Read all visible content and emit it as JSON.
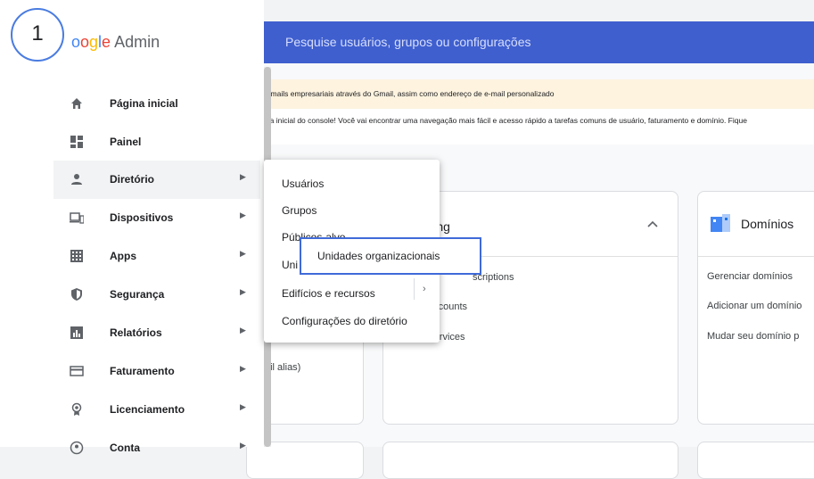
{
  "step_badge": "1",
  "logo": {
    "brand": "oogle",
    "product": "Admin"
  },
  "search": {
    "placeholder": "Pesquise usuários, grupos ou configurações"
  },
  "banners": {
    "warning": "e-mails empresariais através do Gmail, assim como endereço de e-mail personalizado",
    "info": "ina inicial do console! Você vai encontrar uma navegação mais fácil e acesso rápido a tarefas comuns de usuário, faturamento e domínio. Fique"
  },
  "nav": [
    {
      "label": "Página inicial",
      "icon": "home-icon",
      "has_arrow": false
    },
    {
      "label": "Painel",
      "icon": "dashboard-icon",
      "has_arrow": false
    },
    {
      "label": "Diretório",
      "icon": "person-icon",
      "has_arrow": true,
      "active": true
    },
    {
      "label": "Dispositivos",
      "icon": "devices-icon",
      "has_arrow": true
    },
    {
      "label": "Apps",
      "icon": "apps-grid-icon",
      "has_arrow": true
    },
    {
      "label": "Segurança",
      "icon": "shield-icon",
      "has_arrow": true
    },
    {
      "label": "Relatórios",
      "icon": "bar-chart-icon",
      "has_arrow": true
    },
    {
      "label": "Faturamento",
      "icon": "credit-card-icon",
      "has_arrow": true
    },
    {
      "label": "Licenciamento",
      "icon": "license-icon",
      "has_arrow": true
    },
    {
      "label": "Conta",
      "icon": "account-icon",
      "has_arrow": true
    }
  ],
  "dropdown": {
    "items": [
      "Usuários",
      "Grupos",
      "Públicos-alvo",
      "Unidades organizacionais",
      "Edifícios e recursos",
      "Configurações do diretório"
    ],
    "visible": [
      "Usuários",
      "Grupos",
      "Públicos-alvo",
      "Uni",
      "Edifícios e recursos",
      "Configurações do diretório"
    ],
    "highlighted": "Unidades organizacionais"
  },
  "cards": {
    "users_partial": "ail alias)",
    "billing": {
      "title": "lling",
      "links": [
        "subscriptions",
        "accounts",
        "services"
      ],
      "links_visible": [
        "scriptions",
        "accounts",
        "e services"
      ]
    },
    "domains": {
      "title": "Domínios",
      "links": [
        "Gerenciar domínios",
        "Adicionar um domínio",
        "Mudar seu domínio p"
      ]
    }
  },
  "colors": {
    "header": "#3f5fcf",
    "highlight_border": "#3f6ad8",
    "warning_bg": "#fdf3df"
  }
}
